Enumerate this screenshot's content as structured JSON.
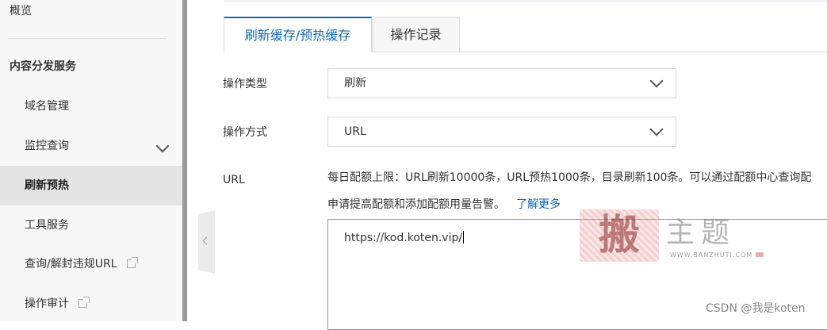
{
  "sidebar": {
    "overview": "概览",
    "section_title": "内容分发服务",
    "items": [
      {
        "label": "域名管理"
      },
      {
        "label": "监控查询"
      },
      {
        "label": "刷新预热"
      },
      {
        "label": "工具服务"
      },
      {
        "label": "查询/解封违规URL"
      },
      {
        "label": "操作审计"
      }
    ]
  },
  "tabs": [
    {
      "label": "刷新缓存/预热缓存"
    },
    {
      "label": "操作记录"
    }
  ],
  "form": {
    "op_type_label": "操作类型",
    "op_type_value": "刷新",
    "op_mode_label": "操作方式",
    "op_mode_value": "URL",
    "url_label": "URL",
    "quota_note_line1": "每日配额上限：URL刷新10000条，URL预热1000条，目录刷新100条。可以通过配额中心查询配",
    "quota_note_line2": "申请提高配额和添加配额用量告警。",
    "learn_more": "了解更多",
    "url_value": "https://kod.koten.vip/"
  },
  "watermark": {
    "stamp": "搬",
    "text": "主题",
    "url": "WWW.BANZHUTI.COM",
    "csdn": "CSDN @我是koten"
  },
  "colors": {
    "accent": "#0f6ab4",
    "sidebar_bg": "#f7f7f7",
    "active_bg": "#e4e4e4"
  }
}
